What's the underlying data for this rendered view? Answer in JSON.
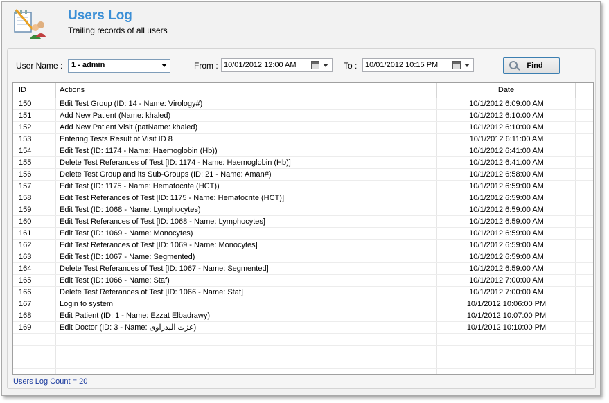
{
  "header": {
    "title": "Users Log",
    "subtitle": "Trailing records of all users"
  },
  "filters": {
    "user_label": "User Name :",
    "user_value": "1 - admin",
    "from_label": "From :",
    "from_value": "10/01/2012 12:00 AM",
    "to_label": "To :",
    "to_value": "10/01/2012 10:15 PM",
    "find_label": "Find"
  },
  "table": {
    "columns": [
      "ID",
      "Actions",
      "Date"
    ],
    "rows": [
      {
        "id": "150",
        "action": "Edit Test Group (ID: 14 - Name: Virology#)",
        "date": "10/1/2012 6:09:00 AM"
      },
      {
        "id": "151",
        "action": "Add New Patient (Name: khaled)",
        "date": "10/1/2012 6:10:00 AM"
      },
      {
        "id": "152",
        "action": "Add New Patient Visit (patName: khaled)",
        "date": "10/1/2012 6:10:00 AM"
      },
      {
        "id": "153",
        "action": "Entering Tests Result of Visit ID 8",
        "date": "10/1/2012 6:11:00 AM"
      },
      {
        "id": "154",
        "action": "Edit Test (ID: 1174 - Name: Haemoglobin (Hb))",
        "date": "10/1/2012 6:41:00 AM"
      },
      {
        "id": "155",
        "action": "Delete Test Referances of Test [ID: 1174 - Name: Haemoglobin (Hb)]",
        "date": "10/1/2012 6:41:00 AM"
      },
      {
        "id": "156",
        "action": "Delete Test Group and its Sub-Groups (ID: 21 - Name: Aman#)",
        "date": "10/1/2012 6:58:00 AM"
      },
      {
        "id": "157",
        "action": "Edit Test (ID: 1175 - Name: Hematocrite (HCT))",
        "date": "10/1/2012 6:59:00 AM"
      },
      {
        "id": "158",
        "action": "Edit Test Referances of Test [ID: 1175 - Name: Hematocrite (HCT)]",
        "date": "10/1/2012 6:59:00 AM"
      },
      {
        "id": "159",
        "action": "Edit Test (ID: 1068 - Name: Lymphocytes)",
        "date": "10/1/2012 6:59:00 AM"
      },
      {
        "id": "160",
        "action": "Edit Test Referances of Test [ID: 1068 - Name: Lymphocytes]",
        "date": "10/1/2012 6:59:00 AM"
      },
      {
        "id": "161",
        "action": "Edit Test (ID: 1069 - Name: Monocytes)",
        "date": "10/1/2012 6:59:00 AM"
      },
      {
        "id": "162",
        "action": "Edit Test Referances of Test [ID: 1069 - Name: Monocytes]",
        "date": "10/1/2012 6:59:00 AM"
      },
      {
        "id": "163",
        "action": "Edit Test (ID: 1067 - Name: Segmented)",
        "date": "10/1/2012 6:59:00 AM"
      },
      {
        "id": "164",
        "action": "Delete Test Referances of Test [ID: 1067 - Name: Segmented]",
        "date": "10/1/2012 6:59:00 AM"
      },
      {
        "id": "165",
        "action": "Edit Test (ID: 1066 - Name: Staf)",
        "date": "10/1/2012 7:00:00 AM"
      },
      {
        "id": "166",
        "action": "Delete Test Referances of Test [ID: 1066 - Name: Staf]",
        "date": "10/1/2012 7:00:00 AM"
      },
      {
        "id": "167",
        "action": "Login to system",
        "date": "10/1/2012 10:06:00 PM"
      },
      {
        "id": "168",
        "action": "Edit Patient (ID: 1 - Name: Ezzat Elbadrawy)",
        "date": "10/1/2012 10:07:00 PM"
      },
      {
        "id": "169",
        "action": "Edit Doctor (ID: 3 - Name: عزت البدراوى)",
        "date": "10/1/2012 10:10:00 PM"
      }
    ]
  },
  "footer": {
    "count_text": "Users Log Count = 20"
  },
  "colors": {
    "title": "#3b8fd6",
    "count": "#1a3a9e"
  }
}
